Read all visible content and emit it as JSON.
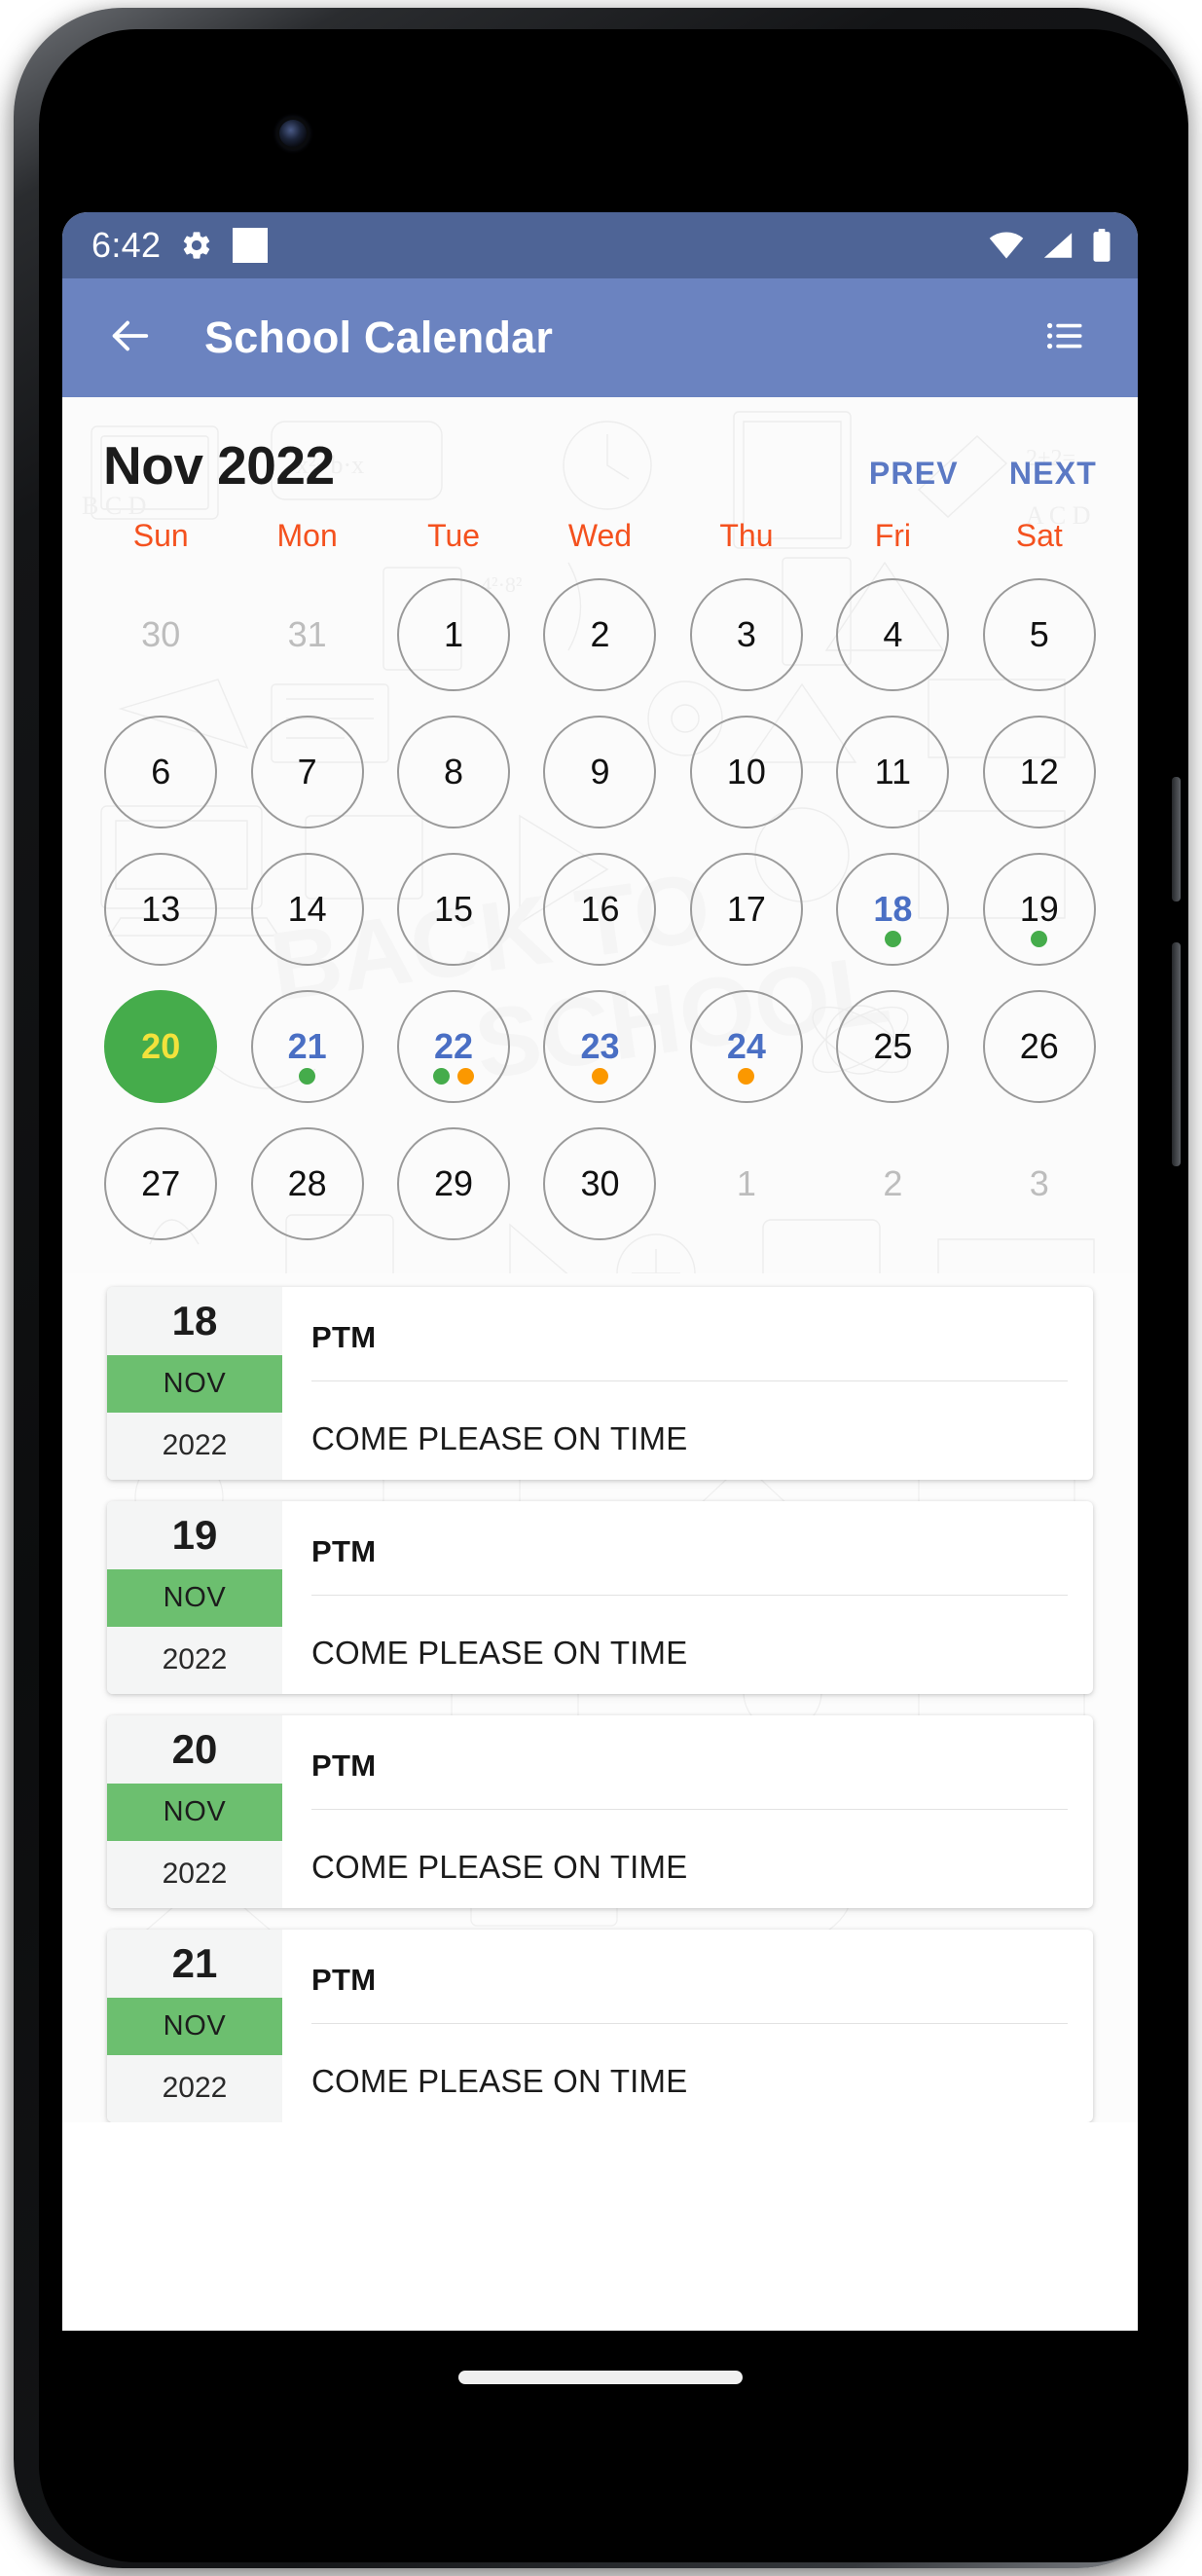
{
  "status_bar": {
    "time": "6:42",
    "icons": [
      "gear-icon",
      "notification-square-icon",
      "wifi-icon",
      "cellular-signal-icon",
      "battery-icon"
    ],
    "background_color": "#4e6496"
  },
  "app_bar": {
    "back_icon": "back-arrow-icon",
    "title": "School Calendar",
    "menu_icon": "list-menu-icon",
    "background_color": "#6b83c0"
  },
  "calendar": {
    "month_label": "Nov 2022",
    "prev_label": "PREV",
    "next_label": "NEXT",
    "accent_color": "#5b79c4",
    "weekday_color": "#f4511e",
    "today_color": "#45ac4b",
    "today_text_color": "#f2e23c",
    "event_dot_colors": {
      "green": "#45ac4b",
      "orange": "#fb9800"
    },
    "weekdays": [
      "Sun",
      "Mon",
      "Tue",
      "Wed",
      "Thu",
      "Fri",
      "Sat"
    ],
    "days": [
      {
        "n": "30",
        "outside": true,
        "style": "muted",
        "dots": []
      },
      {
        "n": "31",
        "outside": true,
        "style": "muted",
        "dots": []
      },
      {
        "n": "1",
        "outside": false,
        "style": "normal",
        "dots": []
      },
      {
        "n": "2",
        "outside": false,
        "style": "normal",
        "dots": []
      },
      {
        "n": "3",
        "outside": false,
        "style": "normal",
        "dots": []
      },
      {
        "n": "4",
        "outside": false,
        "style": "normal",
        "dots": []
      },
      {
        "n": "5",
        "outside": false,
        "style": "normal",
        "dots": []
      },
      {
        "n": "6",
        "outside": false,
        "style": "normal",
        "dots": []
      },
      {
        "n": "7",
        "outside": false,
        "style": "normal",
        "dots": []
      },
      {
        "n": "8",
        "outside": false,
        "style": "normal",
        "dots": []
      },
      {
        "n": "9",
        "outside": false,
        "style": "normal",
        "dots": []
      },
      {
        "n": "10",
        "outside": false,
        "style": "normal",
        "dots": []
      },
      {
        "n": "11",
        "outside": false,
        "style": "normal",
        "dots": []
      },
      {
        "n": "12",
        "outside": false,
        "style": "normal",
        "dots": []
      },
      {
        "n": "13",
        "outside": false,
        "style": "normal",
        "dots": []
      },
      {
        "n": "14",
        "outside": false,
        "style": "normal",
        "dots": []
      },
      {
        "n": "15",
        "outside": false,
        "style": "normal",
        "dots": []
      },
      {
        "n": "16",
        "outside": false,
        "style": "normal",
        "dots": []
      },
      {
        "n": "17",
        "outside": false,
        "style": "normal",
        "dots": []
      },
      {
        "n": "18",
        "outside": false,
        "style": "blue",
        "dots": [
          "green"
        ]
      },
      {
        "n": "19",
        "outside": false,
        "style": "normal",
        "dots": [
          "green"
        ]
      },
      {
        "n": "20",
        "outside": false,
        "style": "today",
        "dots": []
      },
      {
        "n": "21",
        "outside": false,
        "style": "blue",
        "dots": [
          "green"
        ]
      },
      {
        "n": "22",
        "outside": false,
        "style": "blue",
        "dots": [
          "green",
          "orange"
        ]
      },
      {
        "n": "23",
        "outside": false,
        "style": "blue",
        "dots": [
          "orange"
        ]
      },
      {
        "n": "24",
        "outside": false,
        "style": "blue",
        "dots": [
          "orange"
        ]
      },
      {
        "n": "25",
        "outside": false,
        "style": "normal",
        "dots": []
      },
      {
        "n": "26",
        "outside": false,
        "style": "normal",
        "dots": []
      },
      {
        "n": "27",
        "outside": false,
        "style": "normal",
        "dots": []
      },
      {
        "n": "28",
        "outside": false,
        "style": "normal",
        "dots": []
      },
      {
        "n": "29",
        "outside": false,
        "style": "normal",
        "dots": []
      },
      {
        "n": "30",
        "outside": false,
        "style": "normal",
        "dots": []
      },
      {
        "n": "1",
        "outside": true,
        "style": "muted",
        "dots": []
      },
      {
        "n": "2",
        "outside": true,
        "style": "muted",
        "dots": []
      },
      {
        "n": "3",
        "outside": true,
        "style": "muted",
        "dots": []
      }
    ]
  },
  "events": [
    {
      "day": "18",
      "month": "NOV",
      "year": "2022",
      "title": "PTM",
      "description": "COME PLEASE ON TIME",
      "partial": false
    },
    {
      "day": "19",
      "month": "NOV",
      "year": "2022",
      "title": "PTM",
      "description": "COME PLEASE ON TIME",
      "partial": false
    },
    {
      "day": "20",
      "month": "NOV",
      "year": "2022",
      "title": "PTM",
      "description": "COME PLEASE ON TIME",
      "partial": false
    },
    {
      "day": "21",
      "month": "NOV",
      "year": "2022",
      "title": "PTM",
      "description": "COME PLEASE ON TIME",
      "partial": true
    }
  ],
  "system_nav": {
    "gesture_pill": "home-gesture-pill"
  }
}
